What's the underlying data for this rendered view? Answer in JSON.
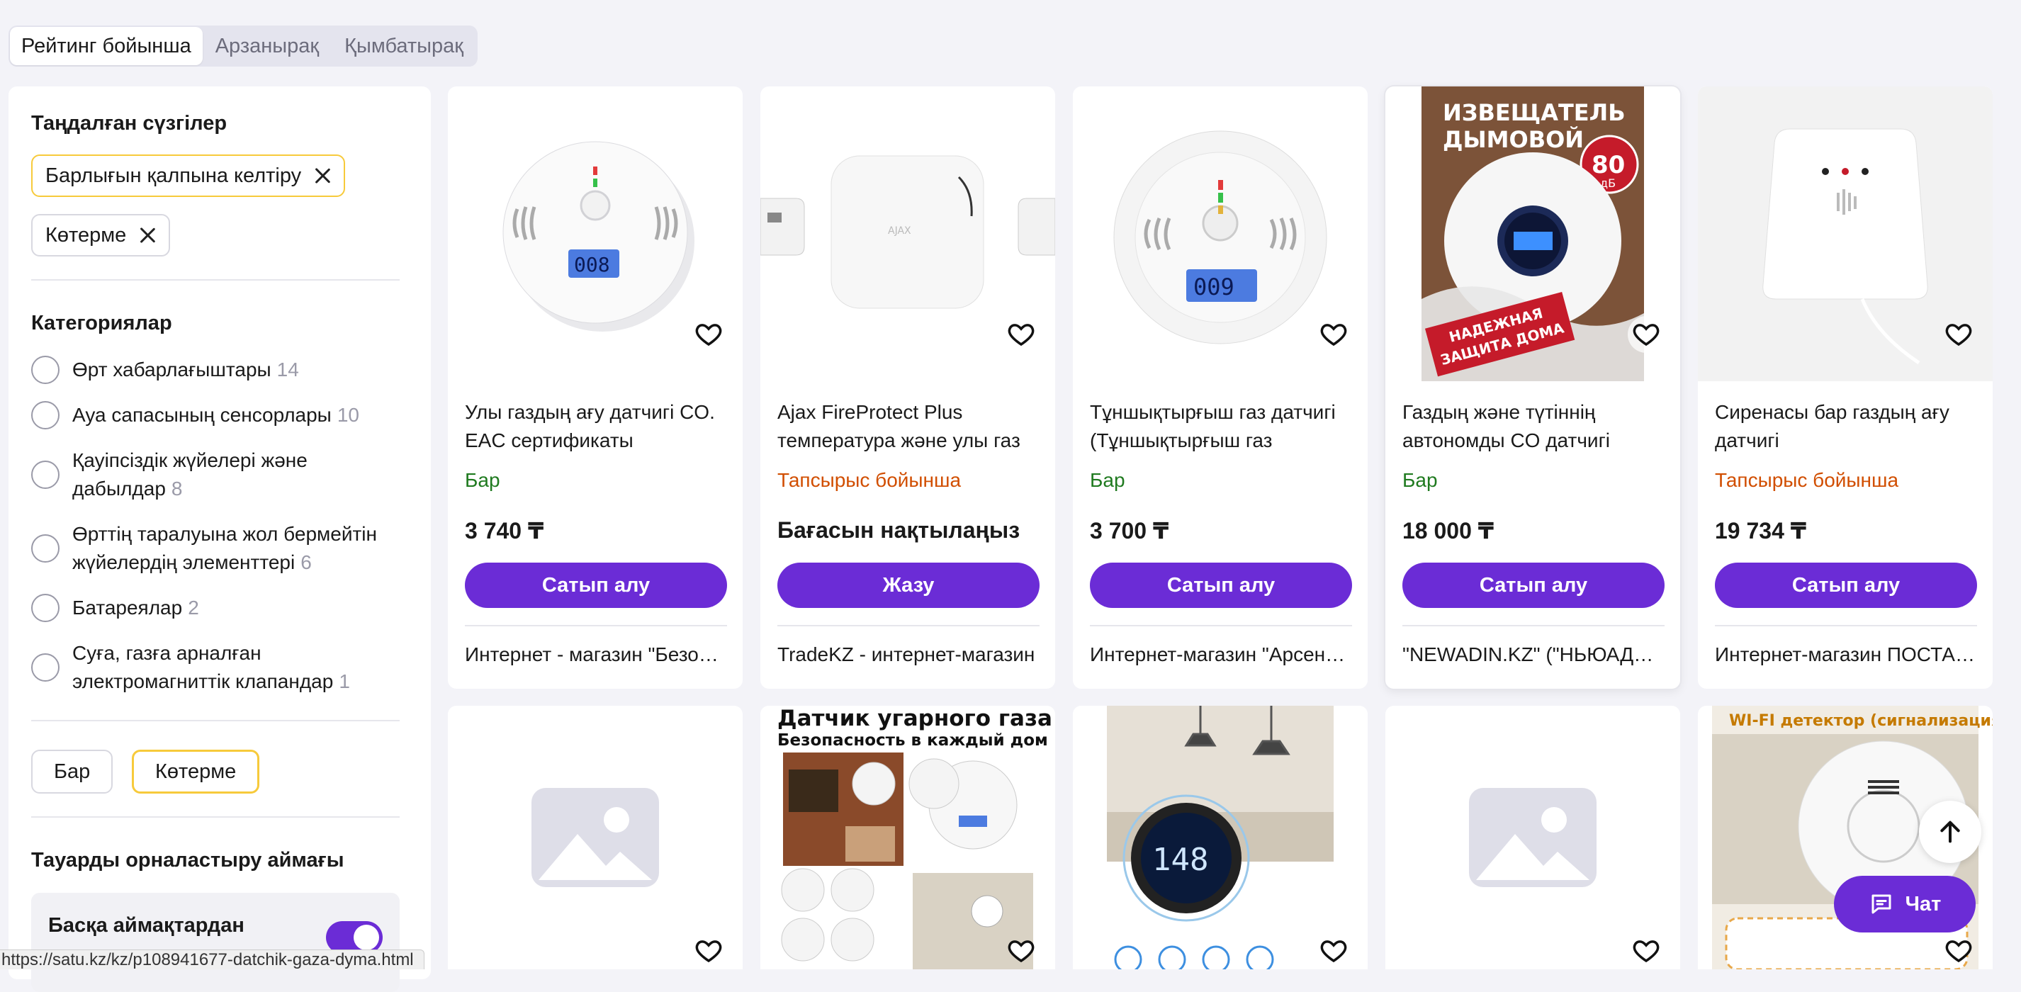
{
  "sort": {
    "options": [
      "Рейтинг бойынша",
      "Арзанырақ",
      "Қымбатырақ"
    ],
    "active": 0
  },
  "filters": {
    "title": "Таңдалған сүзгілер",
    "reset_all": "Барлығын қалпына келтіру",
    "chip": "Көтерме",
    "categories_title": "Категориялар",
    "categories": [
      {
        "label": "Өрт хабарлағыштары",
        "count": "14"
      },
      {
        "label": "Ауа сапасының сенсорлары",
        "count": "10"
      },
      {
        "label": "Қауіпсіздік жүйелері және дабылдар",
        "count": "8"
      },
      {
        "label": "Өрттің таралуына жол бермейтін жүйелердің элементтері",
        "count": "6"
      },
      {
        "label": "Батареялар",
        "count": "2"
      },
      {
        "label": "Суға, газға арналған электромагниттік клапандар",
        "count": "1"
      }
    ],
    "availability": [
      "Бар",
      "Көтерме"
    ],
    "region_title": "Тауарды орналастыру аймағы",
    "region_toggle_label": "Басқа аймақтардан"
  },
  "products": [
    {
      "title": "Улы газдың ағу датчигі CO. EAC сертификаты",
      "status": "Бар",
      "price": "3 740 ₸",
      "button": "Сатып алу",
      "seller": "Интернет - магазин \"Безопасный дом\""
    },
    {
      "title": "Ajax FireProtect Plus температура және улы газ",
      "status": "Тапсырыс бойынша",
      "price": "Бағасын нақтылаңыз",
      "button": "Жазу",
      "seller": "TradeKZ - интернет-магазин"
    },
    {
      "title": "Тұншықтырғыш газ датчигі (Тұншықтырғыш газ",
      "status": "Бар",
      "price": "3 700 ₸",
      "button": "Сатып алу",
      "seller": "Интернет-магазин \"Арсенал\""
    },
    {
      "title": "Газдың және түтіннің автономды CO датчигі",
      "status": "Бар",
      "price": "18 000 ₸",
      "button": "Сатып алу",
      "seller": "\"NEWADIN.KZ\" (\"НЬЮАДИН\")"
    },
    {
      "title": "Сиренасы бар газдың ағу датчигі",
      "status": "Тапсырыс бойынша",
      "price": "19 734 ₸",
      "button": "Сатып алу",
      "seller": "Интернет-магазин ПОСТАВЩИК"
    }
  ],
  "image_text": {
    "poster_line1": "ИЗВЕЩАТЕЛЬ",
    "poster_line2": "ДЫМОВОЙ",
    "poster_badge": "80",
    "poster_badge_unit": "дБ",
    "poster_bottom1": "НАДЕЖНАЯ",
    "poster_bottom2": "ЗАЩИТА ДОМА",
    "lcd1": "008",
    "lcd3": "009",
    "co_title": "Датчик угарного газа",
    "co_sub": "Безопасность в каждый дом",
    "wifi_title": "WI-FI детектор (сигнализация) дыма",
    "gas_lcd": "148"
  },
  "chat_label": "Чат",
  "status_url": "https://satu.kz/kz/p108941677-datchik-gaza-dyma.html"
}
